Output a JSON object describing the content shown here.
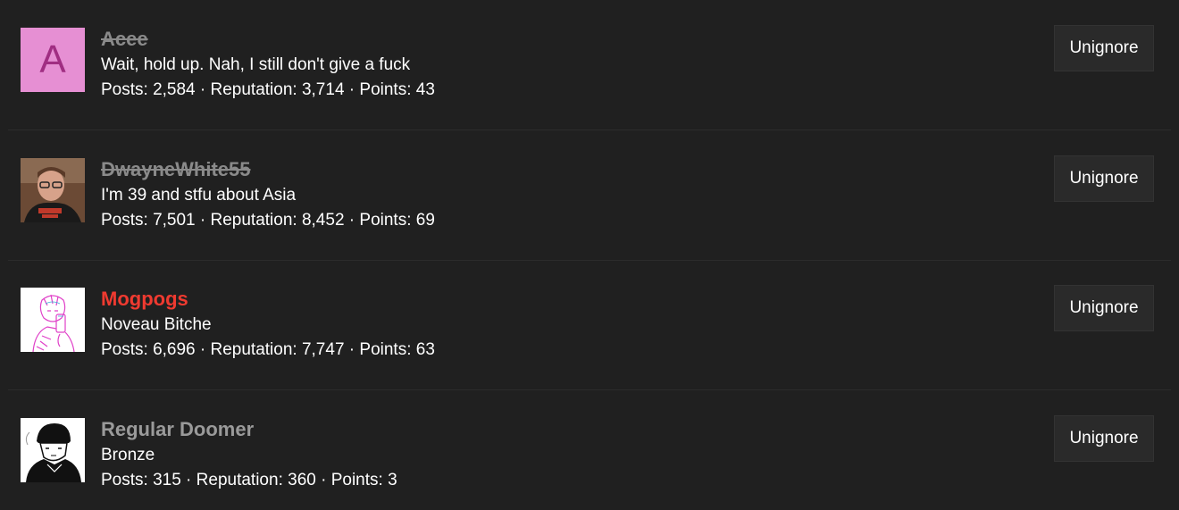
{
  "users": [
    {
      "name": "Acee",
      "status": "ignored",
      "avatar": {
        "kind": "letter",
        "letter": "A",
        "bg": "#e68fd3",
        "fg": "#a02e82"
      },
      "title": "Wait, hold up. Nah, I still don't give a fuck",
      "stats": "Posts: 2,584 · Reputation: 3,714 · Points: 43",
      "button": "Unignore"
    },
    {
      "name": "DwayneWhite55",
      "status": "ignored",
      "avatar": {
        "kind": "photo",
        "subject": "man-with-glasses"
      },
      "title": "I'm 39 and stfu about Asia",
      "stats": "Posts: 7,501 · Reputation: 8,452 · Points: 69",
      "button": "Unignore"
    },
    {
      "name": "Mogpogs",
      "status": "highlighted",
      "name_color": "#f03a30",
      "avatar": {
        "kind": "drawing",
        "subject": "pink-sketch-selfie"
      },
      "title": "Noveau Bitche",
      "stats": "Posts: 6,696 · Reputation: 7,747 · Points: 63",
      "button": "Unignore"
    },
    {
      "name": "Regular Doomer",
      "status": "normal",
      "avatar": {
        "kind": "drawing",
        "subject": "doomer-beanie"
      },
      "title": "Bronze",
      "stats": "Posts: 315 · Reputation: 360 · Points: 3",
      "button": "Unignore"
    }
  ],
  "colors": {
    "background": "#202020",
    "button_bg": "#2a2a2a",
    "ignored_name": "#8a8a8a",
    "text": "#ffffff"
  }
}
